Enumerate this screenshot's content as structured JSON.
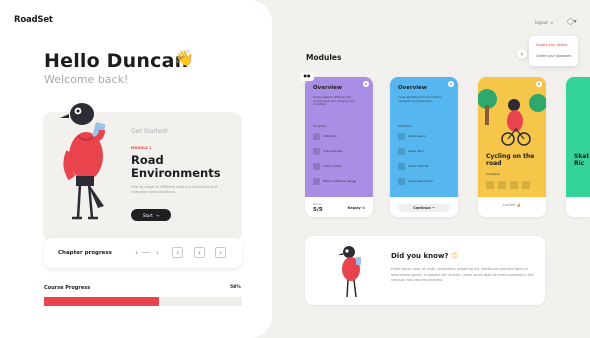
{
  "app": {
    "logo": "RoadSet"
  },
  "header": {
    "greeting": "Hello Duncan",
    "wave_emoji": "👋",
    "subtitle": "Welcome back!"
  },
  "hero": {
    "eyebrow": "Get Started!",
    "module_tag": "MODULE 1",
    "title": "Road Environments",
    "description": "How to adapt to different road environments and changing road conditions",
    "start_label": "Start",
    "start_icon": "→"
  },
  "chapter_progress": {
    "label": "Chapter progress",
    "steps": [
      "1",
      "2",
      "3",
      "4",
      "5"
    ]
  },
  "course_progress": {
    "label": "Course Progress",
    "percent_label": "58%",
    "fraction": 0.58
  },
  "topbar": {
    "logout_label": "logout",
    "logout_icon": "⇥",
    "user_icon": "👤",
    "chevron": "▾"
  },
  "account_menu": {
    "items": [
      "Update your details",
      "Create your password"
    ]
  },
  "modules": {
    "title": "Modules",
    "prev_icon": "‹",
    "next_icon": "›",
    "cards": [
      {
        "heading": "Overview",
        "description": "How to adapt to different road environments and changing road conditions",
        "chapters_label": "Chapters",
        "chapters": [
          "In the City",
          "In the Suburbs",
          "In the country",
          "When conditions change"
        ],
        "footer_label": "Done",
        "footer_value": "5/5",
        "action_label": "Replay",
        "action_icon": "↻"
      },
      {
        "heading": "Overview",
        "description": "Cover adjustment of road surfaces, roadworks and distractions...",
        "chapters_label": "Chapters",
        "chapters": [
          "Lorem ipsum",
          "Ipsum dolor",
          "Lorem dolor sit",
          "Lorem ipsum dolor"
        ],
        "action_label": "Continue",
        "action_icon": "→"
      },
      {
        "title": "Cycling on the road",
        "chapters_label": "Chapters",
        "footer_label": "Locked",
        "footer_icon": "🔒"
      },
      {
        "title": "Skat & Ric"
      }
    ]
  },
  "did_you_know": {
    "title": "Did you know?",
    "emoji": "😊",
    "text": "Lorem ipsum dolor sit amet, consectetur adipiscing elit. Vestibulum pharetra ligula sit amet massa iaculis, in posuere elit ultricies. Lorem ipsum dolor sit amet consectetur. Sed vehicula risus sed eros pharetra."
  },
  "colors": {
    "accent_red": "#e9434e",
    "purple": "#a98ee6",
    "blue": "#56b6f0",
    "yellow": "#f6c64a",
    "green": "#34d399",
    "dark": "#1f1f23"
  }
}
